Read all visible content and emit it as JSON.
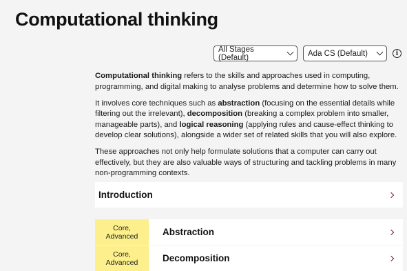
{
  "page": {
    "title": "Computational thinking"
  },
  "filters": {
    "stages_value": "All Stages (Default)",
    "curriculum_value": "Ada CS (Default)",
    "info_icon": "info-icon"
  },
  "intro_text": {
    "p1_term": "Computational thinking",
    "p1_rest": " refers to the skills and approaches used in computing, programming, and digital making to analyse problems and determine how to solve them.",
    "p2_a": "It involves core techniques such as ",
    "p2_abstraction": "abstraction",
    "p2_b": " (focusing on the essential details while filtering out the irrelevant), ",
    "p2_decomposition": "decomposition",
    "p2_c": " (breaking a complex problem into smaller, manageable parts), and ",
    "p2_logical": "logical reasoning",
    "p2_d": " (applying rules and cause-effect thinking to develop clear solutions), alongside a wider set of related skills that you will also explore.",
    "p3": "These approaches not only help formulate solutions that a computer can carry out effectively, but they are also valuable ways of structuring and tackling problems in many non-programming contexts."
  },
  "sections": {
    "introduction": "Introduction",
    "topics": [
      {
        "badge_line1": "Core,",
        "badge_line2": "Advanced",
        "title": "Abstraction"
      },
      {
        "badge_line1": "Core,",
        "badge_line2": "Advanced",
        "title": "Decomposition"
      }
    ]
  },
  "colors": {
    "badge_bg": "#fdf08c",
    "chevron_accent": "#8a1538",
    "page_bg": "#f4f4f4"
  }
}
